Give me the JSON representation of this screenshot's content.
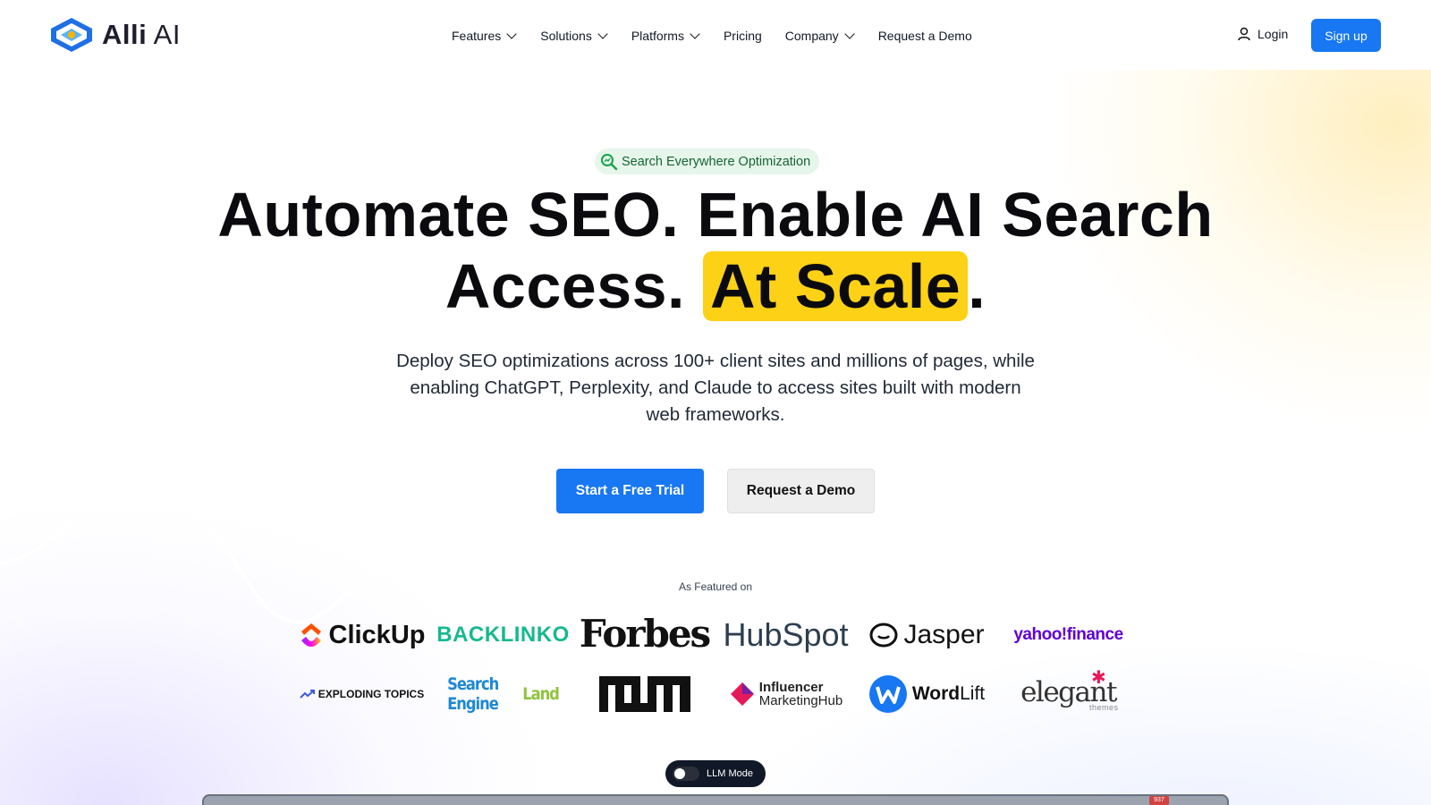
{
  "brand": {
    "name_bold": "Alli",
    "name_rest": "AI",
    "accent": "#1877f2",
    "highlight": "#fcd116"
  },
  "nav": {
    "items": [
      {
        "label": "Features",
        "dropdown": true
      },
      {
        "label": "Solutions",
        "dropdown": true
      },
      {
        "label": "Platforms",
        "dropdown": true
      },
      {
        "label": "Pricing",
        "dropdown": false
      },
      {
        "label": "Company",
        "dropdown": true
      },
      {
        "label": "Request a Demo",
        "dropdown": false
      }
    ],
    "login": "Login",
    "signup": "Sign up"
  },
  "hero": {
    "badge": "Search Everywhere Optimization",
    "title_line1": "Automate SEO. Enable AI Search",
    "title_line2_prefix": "Access. ",
    "title_highlight": "At Scale",
    "title_suffix": ".",
    "subtitle": "Deploy SEO optimizations across 100+ client sites and millions of pages, while enabling ChatGPT, Perplexity, and Claude to access sites built with modern web frameworks.",
    "cta_primary": "Start a Free Trial",
    "cta_secondary": "Request a Demo"
  },
  "featured": {
    "heading": "As Featured on",
    "logos": {
      "clickup": "ClickUp",
      "backlinko": "BACKLINKO",
      "forbes": "Forbes",
      "hubspot": "HubSpot",
      "jasper": "Jasper",
      "yahoo": "yahoo!finance",
      "exploding": "EXPLODING TOPICS",
      "sel_a": "Search Engine ",
      "sel_b": "Land",
      "aim": "AIM",
      "imh_1": "Influencer",
      "imh_2": "MarketingHub",
      "wordlift_a": "Word",
      "wordlift_b": "Lift",
      "elegant": "elegant",
      "elegant_sub": "themes"
    }
  },
  "llm_toggle": {
    "label": "LLM Mode",
    "on": false
  },
  "preview": {
    "badge": "937"
  }
}
